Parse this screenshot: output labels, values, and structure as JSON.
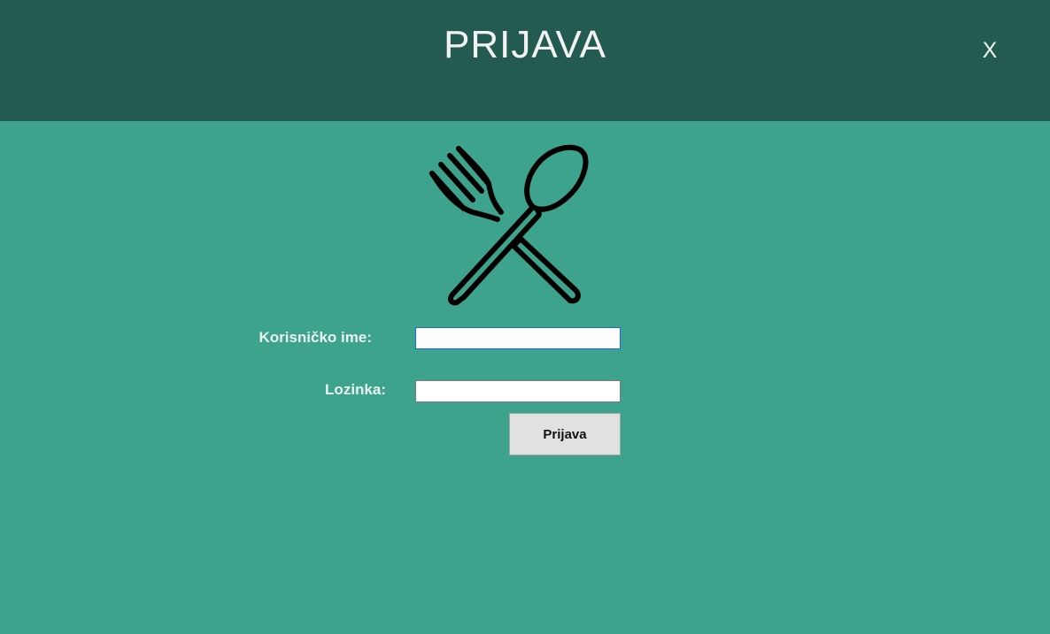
{
  "header": {
    "title": "PRIJAVA",
    "close_label": "X"
  },
  "logo": {
    "icon": "fork-and-spoon-icon"
  },
  "form": {
    "username_label": "Korisničko ime:",
    "username_value": "",
    "password_label": "Lozinka:",
    "password_value": "",
    "submit_label": "Prijava"
  },
  "colors": {
    "background": "#3ea38c",
    "header": "#235b50",
    "header_text": "#f2f2f2",
    "button": "#e1e1e1",
    "focus_border": "#1c6bd1"
  }
}
